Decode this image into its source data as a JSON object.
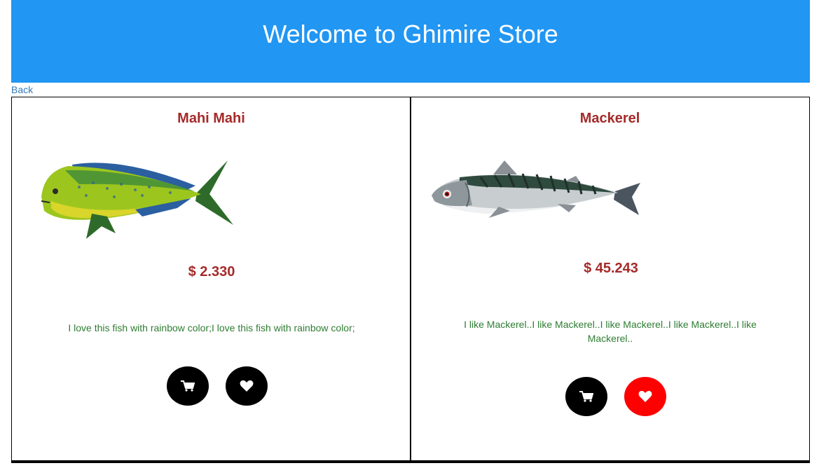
{
  "header": {
    "title": "Welcome to Ghimire Store"
  },
  "nav": {
    "back_label": "Back"
  },
  "colors": {
    "header_bg": "#2196f3",
    "title_color": "#a52a2a",
    "desc_color": "#2e7d32",
    "button_bg": "#000000",
    "favorite_active": "#ff0000"
  },
  "products": [
    {
      "name": "Mahi Mahi",
      "price": "$ 2.330",
      "description": "I love this fish with rainbow color;I love this fish with rainbow color;",
      "image_icon": "mahi-mahi-fish-image",
      "cart_icon": "cart-icon",
      "favorite_icon": "heart-icon",
      "favorited": false
    },
    {
      "name": "Mackerel",
      "price": "$ 45.243",
      "description": "I like Mackerel..I like Mackerel..I like Mackerel..I like Mackerel..I like Mackerel..",
      "image_icon": "mackerel-fish-image",
      "cart_icon": "cart-icon",
      "favorite_icon": "heart-icon",
      "favorited": true
    }
  ]
}
